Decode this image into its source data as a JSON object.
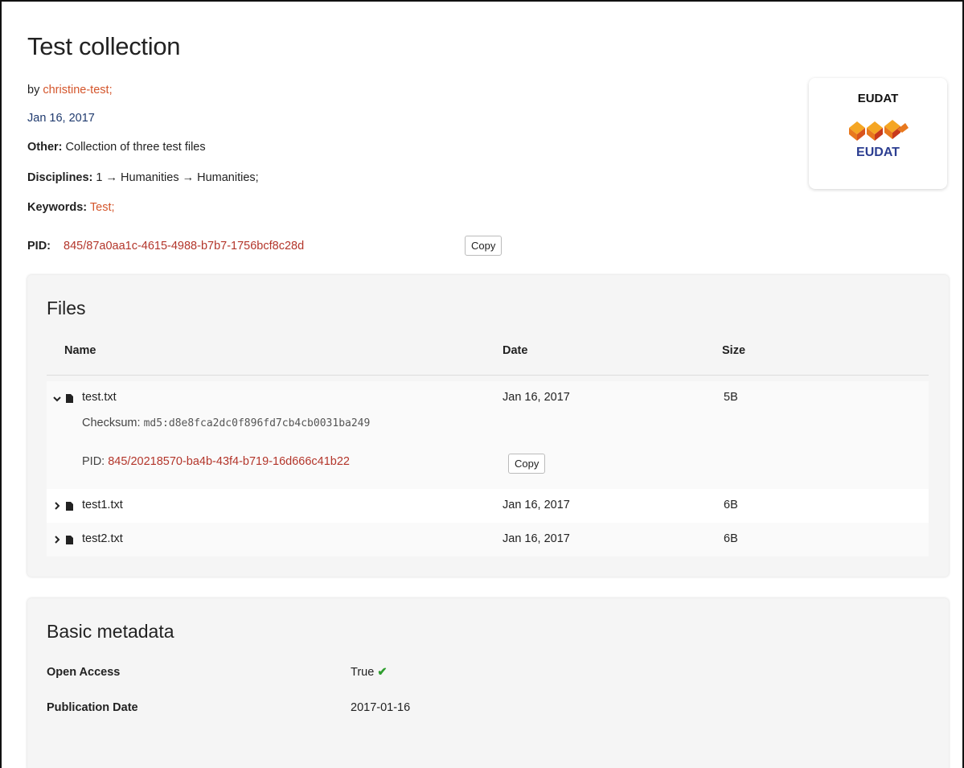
{
  "record": {
    "title": "Test collection",
    "by_prefix": "by",
    "creator": "christine-test",
    "creator_suffix": ";",
    "date": "Jan 16, 2017",
    "other_label": "Other:",
    "other_value": "Collection of three test files",
    "disciplines_label": "Disciplines:",
    "disciplines_value": "1 → Humanities → Humanities;",
    "keywords_label": "Keywords:",
    "keywords_value": "Test;",
    "pid_label": "PID:",
    "pid_value": "845/87a0aa1c-4615-4988-b7b7-1756bcf8c28d",
    "copy_label": "Copy"
  },
  "community": {
    "name": "EUDAT",
    "logo_text": "EUDAT",
    "logo_colors": [
      "#f39c12",
      "#e67e22",
      "#d35400",
      "#c0392b"
    ],
    "logo_text_color": "#2c3e91"
  },
  "files": {
    "heading": "Files",
    "columns": {
      "name": "Name",
      "date": "Date",
      "size": "Size"
    },
    "items": [
      {
        "name": "test.txt",
        "date": "Jan 16, 2017",
        "size": "5B",
        "expanded": true,
        "checksum_label": "Checksum:",
        "checksum_value": "md5:d8e8fca2dc0f896fd7cb4cb0031ba249",
        "pid_label": "PID:",
        "pid_value": "845/20218570-ba4b-43f4-b719-16d666c41b22",
        "copy_label": "Copy"
      },
      {
        "name": "test1.txt",
        "date": "Jan 16, 2017",
        "size": "6B",
        "expanded": false
      },
      {
        "name": "test2.txt",
        "date": "Jan 16, 2017",
        "size": "6B",
        "expanded": false
      }
    ],
    "chevron_expanded": "⌄",
    "chevron_collapsed": "›"
  },
  "basic_metadata": {
    "heading": "Basic metadata",
    "rows": [
      {
        "label": "Open Access",
        "value": "True",
        "icon": "check-icon",
        "icon_glyph": "✔"
      },
      {
        "label": "Publication Date",
        "value": "2017-01-16"
      }
    ]
  },
  "colors": {
    "link": "#d4552b",
    "pid": "#b3352a",
    "date_navy": "#1f3a6e",
    "check_green": "#2e9e2e",
    "panel_bg": "#f5f5f5"
  }
}
